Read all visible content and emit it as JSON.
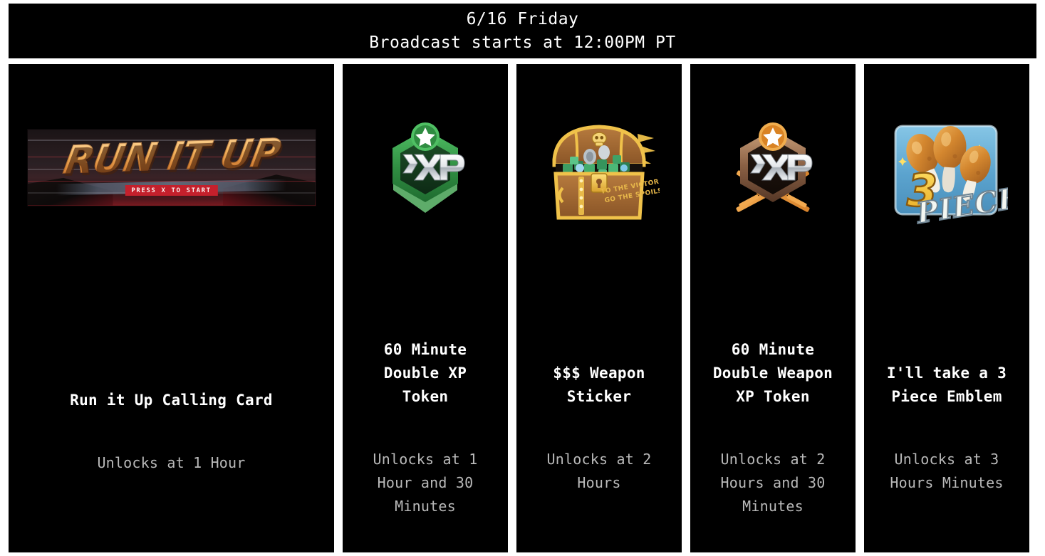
{
  "header": {
    "date_line": "6/16 Friday",
    "broadcast_line": "Broadcast starts at 12:00PM PT"
  },
  "colors": {
    "page_background": "#ffffff",
    "card_background": "#000000",
    "title_text": "#ffffff",
    "unlock_text": "#b9b9b9",
    "xp_green": "#3a9e4d",
    "xp_orange": "#e08a2e",
    "chest_gold": "#f0c24a",
    "chest_wood": "#9a6433",
    "emblem_blue": "#58a7d4",
    "calling_card_gold": "#f3b45f",
    "press_start_red": "#c4202c"
  },
  "cards": [
    {
      "id": "run-it-up-calling-card",
      "art_type": "calling-card",
      "art_label": "run-it-up-calling-card-art",
      "art_title": "RUN IT UP",
      "art_subtitle": "PRESS X TO START",
      "title": "Run it Up Calling Card",
      "unlock": "Unlocks at 1 Hour"
    },
    {
      "id": "double-xp-token",
      "art_type": "xp-badge-green",
      "art_label": "double-xp-token-icon",
      "art_text": "XP",
      "title": "60 Minute\nDouble XP\nToken",
      "unlock": "Unlocks at 1\nHour and 30\nMinutes"
    },
    {
      "id": "weapon-sticker",
      "art_type": "treasure-chest",
      "art_label": "treasure-chest-sticker-icon",
      "art_text": "TO THE VICTOR GO THE SPOILS",
      "title": "$$$ Weapon\nSticker",
      "unlock": "Unlocks at 2\nHours"
    },
    {
      "id": "double-weapon-xp-token",
      "art_type": "xp-badge-orange",
      "art_label": "double-weapon-xp-token-icon",
      "art_text": "XP",
      "title": "60 Minute\nDouble Weapon\nXP Token",
      "unlock": "Unlocks at 2\nHours and 30\nMinutes"
    },
    {
      "id": "three-piece-emblem",
      "art_type": "three-piece-emblem",
      "art_label": "three-piece-emblem-icon",
      "art_text_number": "3",
      "art_text_word": "PIECE",
      "title": "I'll take a 3\nPiece Emblem",
      "unlock": "Unlocks at 3\nHours Minutes"
    }
  ]
}
